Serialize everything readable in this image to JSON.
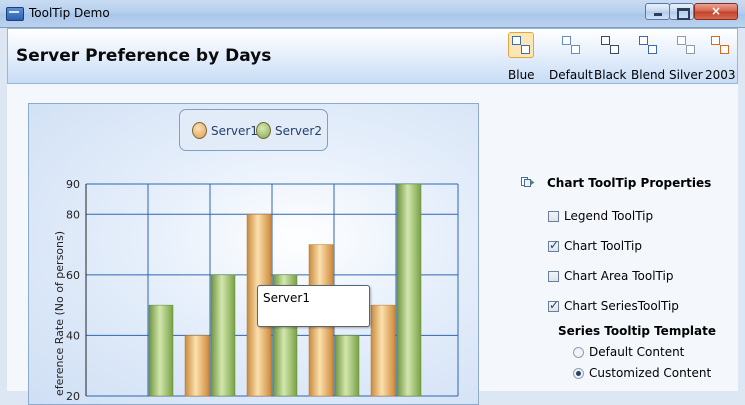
{
  "window": {
    "title": "ToolTip Demo",
    "close_glyph": "×"
  },
  "header": {
    "title": "Server Preference by Days",
    "themes": [
      {
        "label": "Blue",
        "selected": true,
        "color": "#3d6fb4"
      },
      {
        "label": "Default",
        "selected": false,
        "color": "#5f8ec8"
      },
      {
        "label": "Black",
        "selected": false,
        "color": "#3a4a63"
      },
      {
        "label": "Blend",
        "selected": false,
        "color": "#3b6aa8"
      },
      {
        "label": "Silver",
        "selected": false,
        "color": "#8b9bb0"
      },
      {
        "label": "2003",
        "selected": false,
        "color": "#d96a1c"
      }
    ]
  },
  "chart_data": {
    "type": "bar",
    "legend": [
      "Server1",
      "Server2"
    ],
    "legend_position": "top-center",
    "ylabel": "Preference Rate (No of persons)",
    "ylabel_visible": "eference Rate (No of persons)",
    "yticks": [
      20,
      40,
      60,
      80,
      90
    ],
    "ylim": [
      20,
      90
    ],
    "grid": true,
    "series": [
      {
        "name": "Server1",
        "color": "#e8a860",
        "values": [
          null,
          40,
          80,
          70,
          50
        ]
      },
      {
        "name": "Server2",
        "color": "#8fb45c",
        "values": [
          50,
          60,
          60,
          40,
          90
        ]
      }
    ]
  },
  "tooltip": {
    "text": "Server1"
  },
  "properties": {
    "title": "Chart ToolTip Properties",
    "checkboxes": [
      {
        "label": "Legend ToolTip",
        "checked": false
      },
      {
        "label": "Chart ToolTip",
        "checked": true
      },
      {
        "label": "Chart Area ToolTip",
        "checked": false
      },
      {
        "label": "Chart SeriesToolTip",
        "checked": true
      }
    ],
    "series_template_title": "Series Tooltip Template",
    "radios": [
      {
        "label": "Default Content",
        "selected": false
      },
      {
        "label": "Customized Content",
        "selected": true
      }
    ]
  }
}
